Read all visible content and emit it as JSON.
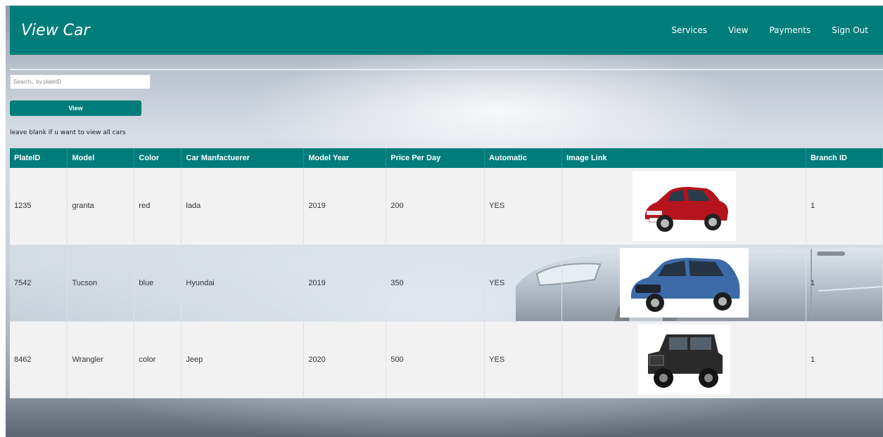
{
  "header": {
    "title": "View Car",
    "nav": [
      "Services",
      "View",
      "Payments",
      "Sign Out"
    ]
  },
  "search": {
    "placeholder": "Search.. by plateID",
    "value": ""
  },
  "view_button": {
    "label": "View"
  },
  "hint": "leave blank if u want to view all cars",
  "table": {
    "columns": [
      "PlateID",
      "Model",
      "Color",
      "Car Manfactuerer",
      "Model Year",
      "Price Per Day",
      "Automatic",
      "Image Link",
      "Branch ID"
    ],
    "rows": [
      {
        "plate": "1235",
        "model": "granta",
        "color": "red",
        "maker": "lada",
        "year": "2019",
        "price": "200",
        "automatic": "YES",
        "image": "red-sedan-icon",
        "branch": "1"
      },
      {
        "plate": "7542",
        "model": "Tucson",
        "color": "blue",
        "maker": "Hyundai",
        "year": "2019",
        "price": "350",
        "automatic": "YES",
        "image": "blue-suv-icon",
        "branch": "1"
      },
      {
        "plate": "8462",
        "model": "Wrangler",
        "color": "color",
        "maker": "Jeep",
        "year": "2020",
        "price": "500",
        "automatic": "YES",
        "image": "black-jeep-icon",
        "branch": "1"
      }
    ]
  },
  "colors": {
    "accent": "#007d7b",
    "red_car": "#b5141c",
    "blue_car": "#3d6aa8",
    "jeep": "#2a2a2a"
  }
}
